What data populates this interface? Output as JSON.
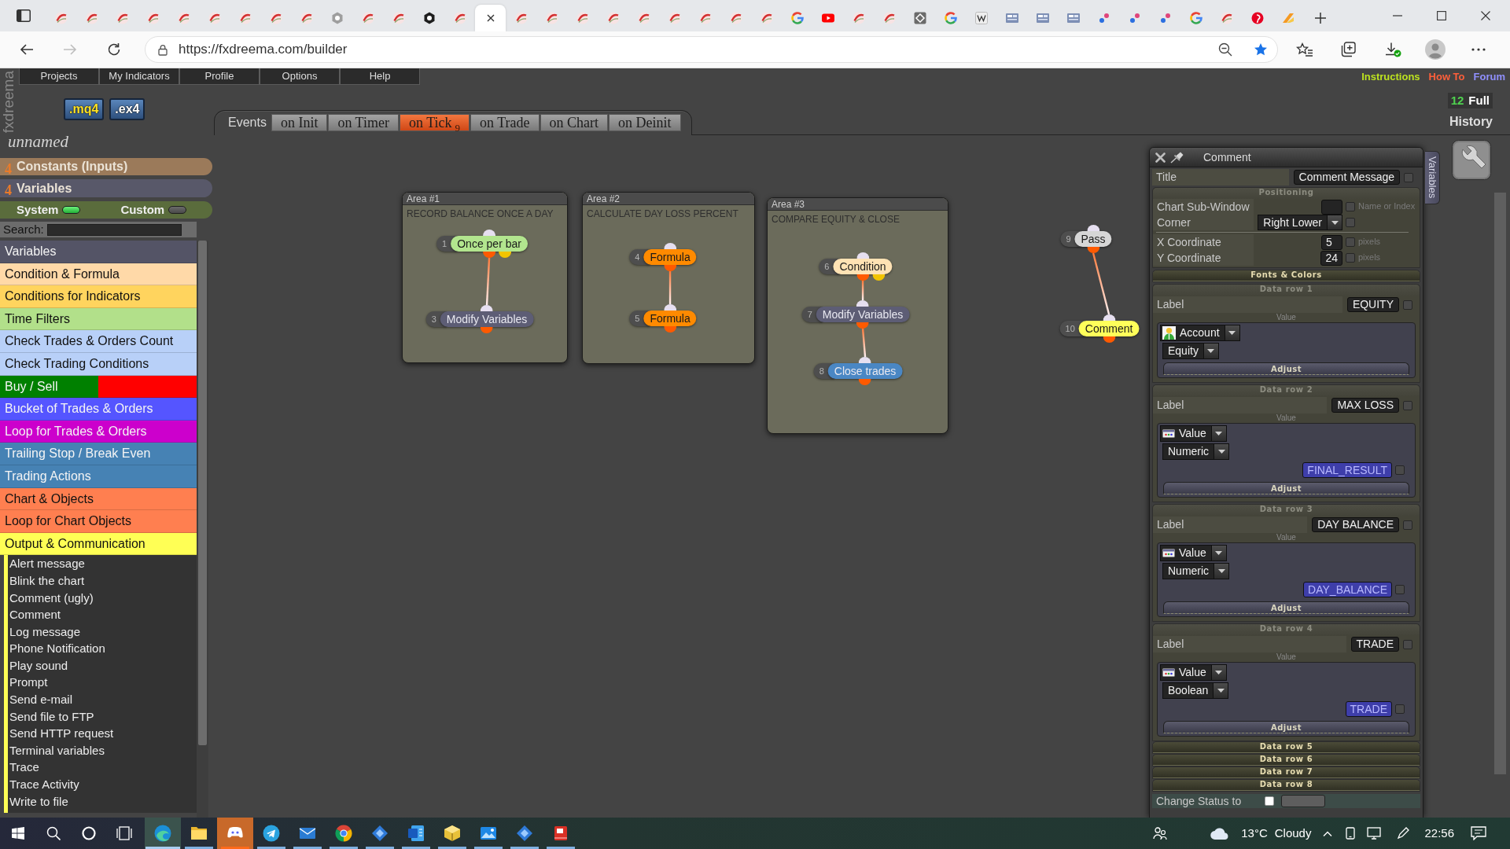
{
  "browser": {
    "tabs": [
      {
        "kind": "swoosh",
        "selected": false
      },
      {
        "kind": "swoosh",
        "selected": false
      },
      {
        "kind": "swoosh",
        "selected": false
      },
      {
        "kind": "swoosh",
        "selected": false
      },
      {
        "kind": "swoosh",
        "selected": false
      },
      {
        "kind": "swoosh",
        "selected": false
      },
      {
        "kind": "swoosh",
        "selected": false
      },
      {
        "kind": "swoosh",
        "selected": false
      },
      {
        "kind": "swoosh",
        "selected": false
      },
      {
        "kind": "hexagon",
        "selected": false
      },
      {
        "kind": "swoosh",
        "selected": false
      },
      {
        "kind": "swoosh",
        "selected": false
      },
      {
        "kind": "hexagon-dark",
        "selected": false
      },
      {
        "kind": "swoosh",
        "selected": false
      },
      {
        "selected": true
      },
      {
        "kind": "swoosh",
        "selected": false
      },
      {
        "kind": "swoosh",
        "selected": false
      },
      {
        "kind": "swoosh",
        "selected": false
      },
      {
        "kind": "swoosh",
        "selected": false
      },
      {
        "kind": "swoosh",
        "selected": false
      },
      {
        "kind": "swoosh",
        "selected": false
      },
      {
        "kind": "swoosh",
        "selected": false
      },
      {
        "kind": "swoosh",
        "selected": false
      },
      {
        "kind": "swoosh",
        "selected": false
      },
      {
        "kind": "ring",
        "selected": false
      },
      {
        "kind": "play",
        "selected": false
      },
      {
        "kind": "swoosh",
        "selected": false
      },
      {
        "kind": "swoosh",
        "selected": false
      },
      {
        "kind": "diamond",
        "selected": false
      },
      {
        "kind": "ring",
        "selected": false
      },
      {
        "kind": "zigzag",
        "selected": false
      },
      {
        "kind": "tile",
        "selected": false
      },
      {
        "kind": "tile",
        "selected": false
      },
      {
        "kind": "tile",
        "selected": false
      },
      {
        "kind": "dots",
        "selected": false
      },
      {
        "kind": "dots",
        "selected": false
      },
      {
        "kind": "dots",
        "selected": false
      },
      {
        "kind": "ring",
        "selected": false
      },
      {
        "kind": "swoosh",
        "selected": false
      },
      {
        "kind": "disc",
        "selected": false
      },
      {
        "kind": "slash",
        "selected": false
      }
    ],
    "forward_disabled": true,
    "url": "https://fxdreema.com/builder",
    "favorited": true
  },
  "menu": {
    "items": [
      "Projects",
      "My Indicators",
      "Profile",
      "Options",
      "Help"
    ],
    "links": [
      {
        "label": "Instructions",
        "color": "#bde31f"
      },
      {
        "label": "How To",
        "color": "#ff5f3a"
      },
      {
        "label": "Forum",
        "color": "#9090ff"
      }
    ]
  },
  "logo": "fxdreema",
  "file_buttons": [
    {
      "label": ".mq4",
      "selected": true
    },
    {
      "label": ".ex4",
      "selected": false
    }
  ],
  "project_name": "unnamed",
  "constants": {
    "count": "4",
    "label": "Constants (Inputs)"
  },
  "variables": {
    "count": "4",
    "label": "Variables"
  },
  "filters": [
    {
      "label": "System",
      "on": true
    },
    {
      "label": "Custom",
      "on": false
    }
  ],
  "search": {
    "label": "Search:"
  },
  "categories": [
    {
      "label": "Variables",
      "color": "#545466"
    },
    {
      "label": "Condition & Formula",
      "color": "#ffd9a8"
    },
    {
      "label": "Conditions for Indicators",
      "color": "#ffd45e"
    },
    {
      "label": "Time Filters",
      "color": "#b2e08a"
    },
    {
      "label": "Check Trades & Orders Count",
      "color": "#b8d0f8"
    },
    {
      "label": "Check Trading Conditions",
      "color": "#b8d0f8"
    },
    {
      "label": "Buy / Sell",
      "color": "#008000",
      "split": {
        "color": "#ff0000"
      }
    },
    {
      "label": "Bucket of Trades & Orders",
      "color": "#5555ff"
    },
    {
      "label": "Loop for Trades & Orders",
      "color": "#cc00cc"
    },
    {
      "label": "Trailing Stop / Break Even",
      "color": "#4682b4"
    },
    {
      "label": "Trading Actions",
      "color": "#4682b4"
    },
    {
      "label": "Chart & Objects",
      "color": "#ff7f50"
    },
    {
      "label": "Loop for Chart Objects",
      "color": "#ff7f50"
    },
    {
      "label": "Output & Communication",
      "color": "#ffff55",
      "children": [
        {
          "label": "Alert message"
        },
        {
          "label": "Blink the chart"
        },
        {
          "label": "Comment (ugly)"
        },
        {
          "label": "Comment"
        },
        {
          "label": "Log message"
        },
        {
          "label": "Phone Notification"
        },
        {
          "label": "Play sound"
        },
        {
          "label": "Prompt"
        },
        {
          "label": "Send e-mail"
        },
        {
          "label": "Send file to FTP"
        },
        {
          "label": "Send HTTP request"
        },
        {
          "label": "Terminal variables"
        },
        {
          "label": "Trace"
        },
        {
          "label": "Trace Activity"
        },
        {
          "label": "Write to file"
        }
      ]
    }
  ],
  "events": {
    "label": "Events",
    "tabs": [
      {
        "label": "on Init",
        "selected": false
      },
      {
        "label": "on Timer",
        "selected": false
      },
      {
        "label": "on Tick",
        "selected": true,
        "count": "9"
      },
      {
        "label": "on Trade",
        "selected": false
      },
      {
        "label": "on Chart",
        "selected": false
      },
      {
        "label": "on Deinit",
        "selected": false
      }
    ]
  },
  "history": {
    "count": "12",
    "mode": "Full",
    "label": "History"
  },
  "areas": [
    {
      "title": "Area #1",
      "caption": "RECORD BALANCE ONCE A DAY",
      "blocks": [
        {
          "number": "1",
          "label": "Once per bar",
          "color": "#b2e58e",
          "false_output": true
        },
        {
          "number": "3",
          "label": "Modify Variables",
          "color": "#5d5d75",
          "false_output": false
        }
      ]
    },
    {
      "title": "Area #2",
      "caption": "CALCULATE DAY LOSS PERCENT",
      "blocks": [
        {
          "number": "4",
          "label": "Formula",
          "color": "#ff8a00",
          "false_output": false
        },
        {
          "number": "5",
          "label": "Formula",
          "color": "#ff8a00",
          "false_output": false
        }
      ]
    },
    {
      "title": "Area #3",
      "caption": "COMPARE EQUITY & CLOSE",
      "blocks": [
        {
          "number": "6",
          "label": "Condition",
          "color": "#ffe2b4",
          "false_output": true
        },
        {
          "number": "7",
          "label": "Modify Variables",
          "color": "#5d5d75",
          "false_output": false
        },
        {
          "number": "8",
          "label": "Close trades",
          "color": "#4a87c4",
          "false_output": false
        }
      ]
    }
  ],
  "free_blocks": [
    {
      "number": "9",
      "label": "Pass",
      "color": "#d6d6d6",
      "false_output": false
    },
    {
      "number": "10",
      "label": "Comment",
      "color": "#ffff5a",
      "false_output": false
    }
  ],
  "properties": {
    "title": "Comment",
    "side_tab": "Variables",
    "title_field": {
      "label": "Title",
      "value": "Comment Message",
      "checked": false
    },
    "sections": [
      {
        "kind": "group",
        "heading": "Positioning",
        "expanded": true,
        "fields": [
          {
            "kind": "input",
            "label": "Chart Sub-Window",
            "checked": false,
            "note": "Name or Index"
          },
          {
            "kind": "select",
            "label": "Corner",
            "value": "Right Lower",
            "checked": false
          },
          {
            "kind": "divider"
          },
          {
            "kind": "input",
            "label": "X Coordinate",
            "value": "5",
            "checked": false,
            "note": "pixels"
          },
          {
            "kind": "input",
            "label": "Y Coordinate",
            "value": "24",
            "checked": false,
            "note": "pixels"
          }
        ]
      },
      {
        "kind": "group",
        "heading": "Fonts & Colors",
        "expanded": false
      },
      {
        "kind": "data_row",
        "heading": "Data row 1",
        "expanded": true,
        "label": {
          "label": "Label",
          "value": "EQUITY",
          "checked": false
        },
        "caption": "Value",
        "source": {
          "kind": "account",
          "value": "Account"
        },
        "type": "Equity",
        "adjust": "Adjust"
      },
      {
        "kind": "data_row",
        "heading": "Data row 2",
        "expanded": true,
        "label": {
          "label": "Label",
          "value": "MAX LOSS",
          "checked": false
        },
        "caption": "Value",
        "source": {
          "kind": "value",
          "value": "Value"
        },
        "type": "Numeric",
        "variable": {
          "value": "FINAL_RESULT",
          "checked": false
        },
        "adjust": "Adjust"
      },
      {
        "kind": "data_row",
        "heading": "Data row 3",
        "expanded": true,
        "label": {
          "label": "Label",
          "value": "DAY BALANCE",
          "checked": false
        },
        "caption": "Value",
        "source": {
          "kind": "value",
          "value": "Value"
        },
        "type": "Numeric",
        "variable": {
          "value": "DAY_BALANCE",
          "checked": false
        },
        "adjust": "Adjust"
      },
      {
        "kind": "data_row",
        "heading": "Data row 4",
        "expanded": true,
        "label": {
          "label": "Label",
          "value": "TRADE",
          "checked": false
        },
        "caption": "Value",
        "source": {
          "kind": "value",
          "value": "Value"
        },
        "type": "Boolean",
        "variable": {
          "value": "TRADE",
          "checked": false
        },
        "adjust": "Adjust"
      },
      {
        "kind": "data_row",
        "heading": "Data row 5",
        "expanded": false
      },
      {
        "kind": "data_row",
        "heading": "Data row 6",
        "expanded": false
      },
      {
        "kind": "data_row",
        "heading": "Data row 7",
        "expanded": false
      },
      {
        "kind": "data_row",
        "heading": "Data row 8",
        "expanded": false
      }
    ],
    "status": {
      "label": "Change Status to",
      "checked": false
    }
  },
  "taskbar": {
    "apps": [
      {
        "kind": "swirl",
        "selected": true,
        "attention": false,
        "running": true
      },
      {
        "kind": "folder",
        "selected": false,
        "attention": false,
        "running": true
      },
      {
        "kind": "controller",
        "selected": false,
        "attention": true,
        "running": true
      },
      {
        "kind": "plane",
        "selected": false,
        "attention": false,
        "running": true
      },
      {
        "kind": "envelope",
        "selected": false,
        "attention": false,
        "running": true
      },
      {
        "kind": "wheel",
        "selected": false,
        "attention": false,
        "running": true
      },
      {
        "kind": "diamond",
        "selected": false,
        "attention": false,
        "running": true
      },
      {
        "kind": "doc",
        "selected": false,
        "attention": false,
        "running": true
      },
      {
        "kind": "cube",
        "selected": false,
        "attention": false,
        "running": true
      },
      {
        "kind": "picture",
        "selected": false,
        "attention": false,
        "running": true
      },
      {
        "kind": "diamond",
        "selected": false,
        "attention": false,
        "running": true
      },
      {
        "kind": "book",
        "selected": false,
        "attention": false,
        "running": true
      }
    ],
    "weather": {
      "temperature": "13°C",
      "condition": "Cloudy"
    },
    "clock": "22:56"
  }
}
